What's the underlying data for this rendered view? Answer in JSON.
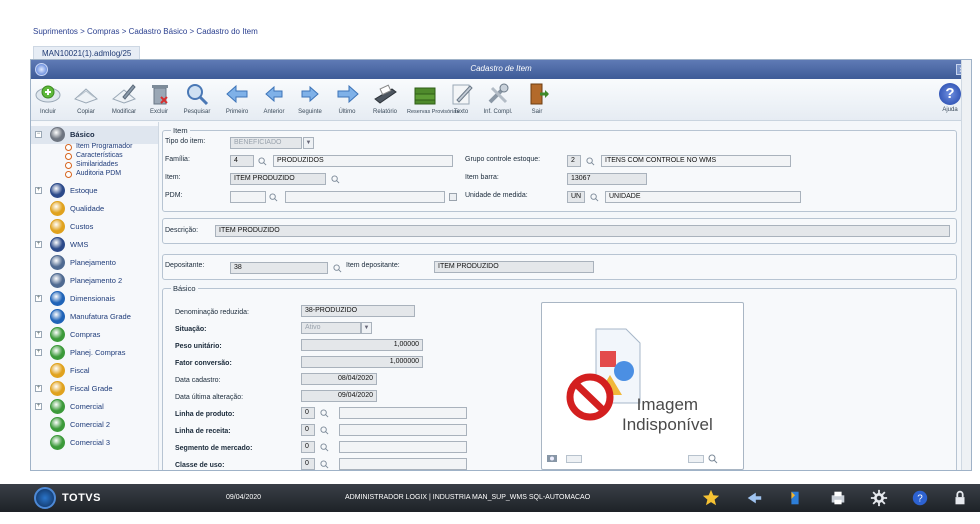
{
  "breadcrumb": "Suprimentos > Compras > Cadastro Básico > Cadastro do Item",
  "session_tab": "MAN10021(1).admlog/25",
  "window": {
    "title": "Cadastro de Item",
    "close": "x"
  },
  "toolbar": {
    "buttons": [
      {
        "label": "Incluir",
        "icon": "add-doc-icon"
      },
      {
        "label": "Copiar",
        "icon": "copy-icon"
      },
      {
        "label": "Modificar",
        "icon": "edit-icon"
      },
      {
        "label": "Excluir",
        "icon": "delete-icon"
      },
      {
        "label": "Pesquisar",
        "icon": "search-icon"
      },
      {
        "label": "Primeiro",
        "icon": "first-icon"
      },
      {
        "label": "Anterior",
        "icon": "previous-icon"
      },
      {
        "label": "Seguinte",
        "icon": "next-icon"
      },
      {
        "label": "Último",
        "icon": "last-icon"
      },
      {
        "label": "Relatório",
        "icon": "printer-icon"
      },
      {
        "label": "Reservas Provisórias",
        "icon": "money-icon"
      },
      {
        "label": "Texto",
        "icon": "text-icon"
      },
      {
        "label": "Inf. Compl.",
        "icon": "tools-icon"
      },
      {
        "label": "Sair",
        "icon": "exit-icon"
      }
    ],
    "help_label": "Ajuda",
    "help_glyph": "?"
  },
  "sidebar": {
    "items": [
      {
        "label": "Básico",
        "color": "#6e7580",
        "expander": "−"
      },
      {
        "label": "Estoque",
        "color": "#2c4a8a",
        "expander": "+"
      },
      {
        "label": "Qualidade",
        "color": "#e0a21e",
        "expander": ""
      },
      {
        "label": "Custos",
        "color": "#e0a21e",
        "expander": ""
      },
      {
        "label": "WMS",
        "color": "#2c4a8a",
        "expander": "+"
      },
      {
        "label": "Planejamento",
        "color": "#4f6a91",
        "expander": ""
      },
      {
        "label": "Planejamento 2",
        "color": "#4f6a91",
        "expander": ""
      },
      {
        "label": "Dimensionais",
        "color": "#2064b8",
        "expander": "+"
      },
      {
        "label": "Manufatura Grade",
        "color": "#2064b8",
        "expander": ""
      },
      {
        "label": "Compras",
        "color": "#3c9a3a",
        "expander": "+"
      },
      {
        "label": "Planej. Compras",
        "color": "#3c9a3a",
        "expander": "+"
      },
      {
        "label": "Fiscal",
        "color": "#e0a21e",
        "expander": ""
      },
      {
        "label": "Fiscal Grade",
        "color": "#e0a21e",
        "expander": "+"
      },
      {
        "label": "Comercial",
        "color": "#3c9a3a",
        "expander": "+"
      },
      {
        "label": "Comercial 2",
        "color": "#3c9a3a",
        "expander": ""
      },
      {
        "label": "Comercial 3",
        "color": "#3c9a3a",
        "expander": ""
      }
    ],
    "sub_items": [
      "Item Programador",
      "Características",
      "Similaridades",
      "Auditoria PDM"
    ]
  },
  "item_group": {
    "legend": "Item",
    "tipo_label": "Tipo do item:",
    "tipo_value": "BENEFICIADO",
    "familia_label": "Família:",
    "familia_code": "4",
    "familia_desc": "PRODUZIDOS",
    "grupo_label": "Grupo controle estoque:",
    "grupo_code": "2",
    "grupo_desc": "ITENS COM CONTROLE NO WMS",
    "item_label": "Item:",
    "item_value": "ITEM PRODUZIDO",
    "item_barra_label": "Item barra:",
    "item_barra_value": "13067",
    "pdm_label": "PDM:",
    "unidade_label": "Unidade de medida:",
    "unidade_code": "UN",
    "unidade_desc": "UNIDADE"
  },
  "descricao": {
    "label": "Descrição:",
    "value": "ITEM PRODUZIDO"
  },
  "depositante": {
    "label": "Depositante:",
    "value": "38",
    "item_label": "Item depositante:",
    "item_value": "ITEM PRODUZIDO"
  },
  "basico": {
    "legend": "Básico",
    "denominacao_label": "Denominação reduzida:",
    "denominacao_value": "38-PRODUZIDO",
    "situacao_label": "Situação:",
    "situacao_value": "Ativo",
    "peso_label": "Peso unitário:",
    "peso_value": "1,00000",
    "fator_label": "Fator conversão:",
    "fator_value": "1,000000",
    "cadastro_label": "Data cadastro:",
    "cadastro_value": "08/04/2020",
    "alteracao_label": "Data última alteração:",
    "alteracao_value": "09/04/2020",
    "linha_produto_label": "Linha de produto:",
    "linha_produto_value": "0",
    "linha_receita_label": "Linha de receita:",
    "linha_receita_value": "0",
    "segmento_label": "Segmento de mercado:",
    "segmento_value": "0",
    "classe_label": "Classe de uso:",
    "classe_value": "0"
  },
  "image": {
    "line1": "Imagem",
    "line2": "Indisponível"
  },
  "taskbar": {
    "brand": "TOTVS",
    "date": "09/04/2020",
    "info": "ADMINISTRADOR LOGIX | INDUSTRIA MAN_SUP_WMS SQL-AUTOMACAO"
  }
}
